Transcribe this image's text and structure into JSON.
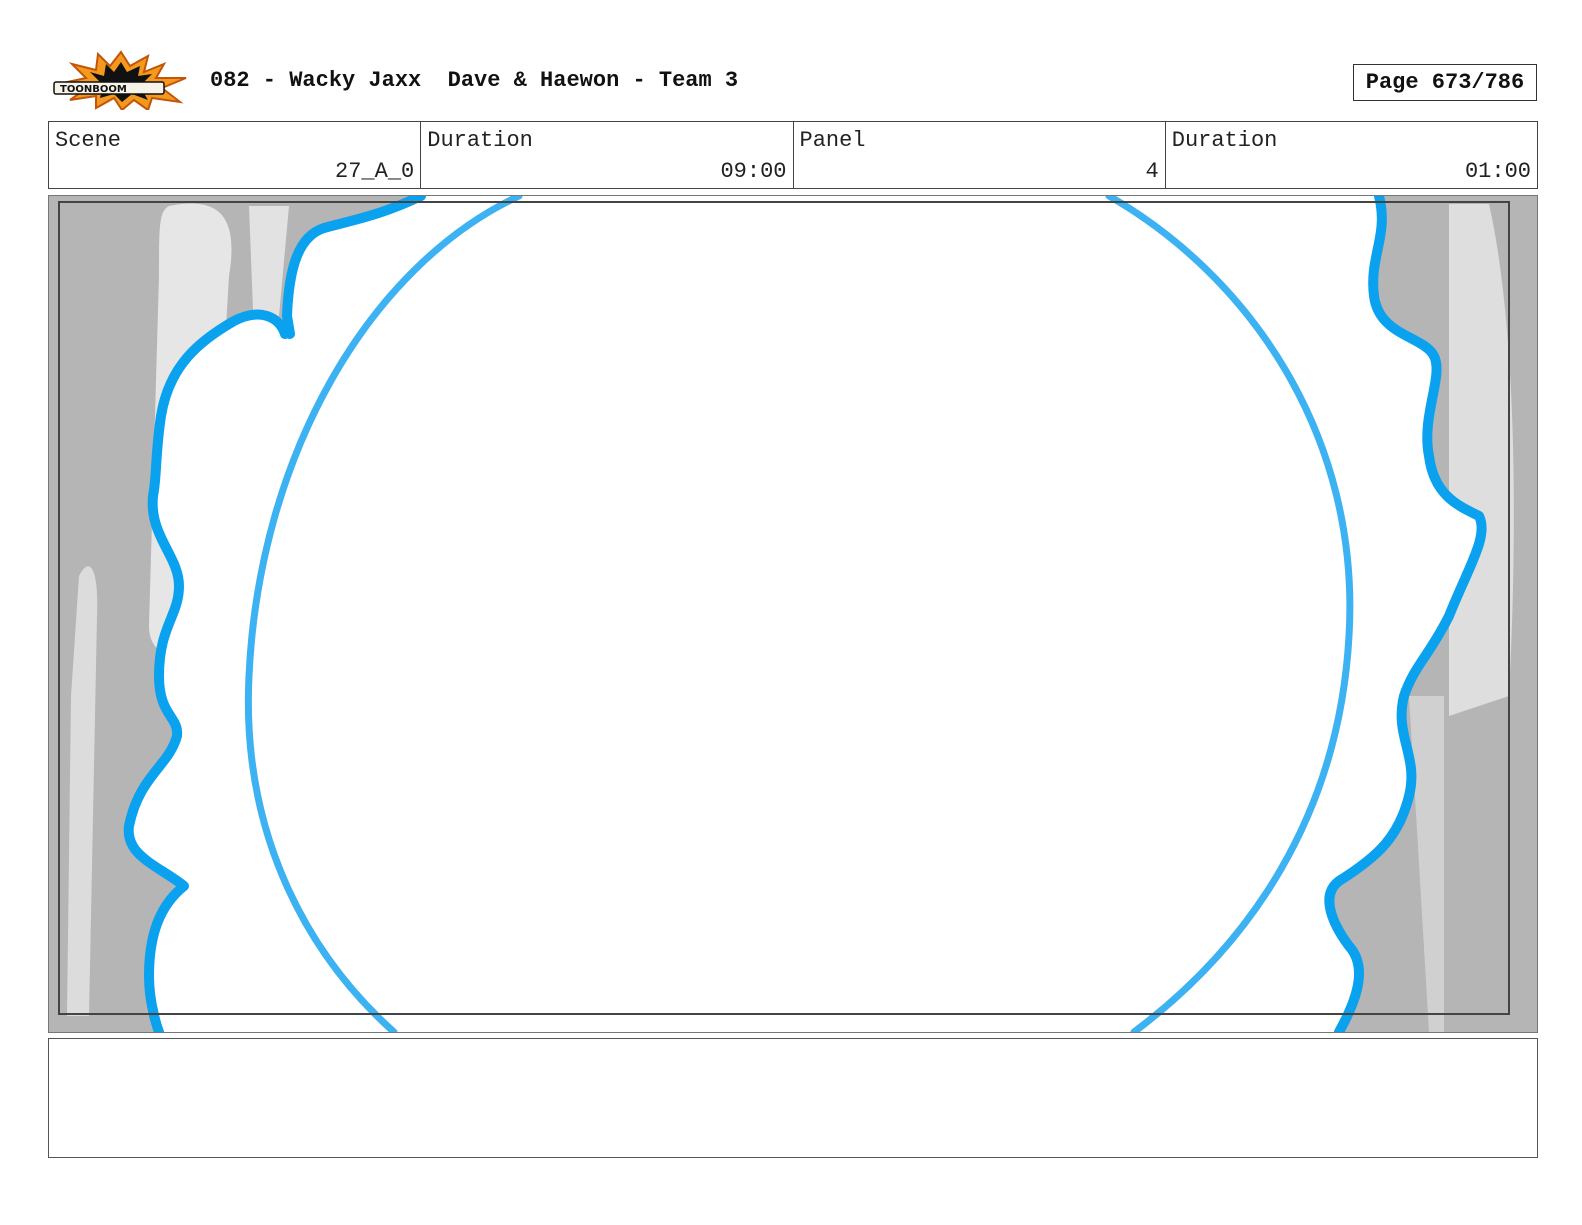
{
  "header": {
    "logo_text": "TOONBOOM",
    "title": "082 - Wacky Jaxx  Dave & Haewon - Team 3",
    "page": "Page 673/786"
  },
  "info": {
    "scene_label": "Scene",
    "scene_value": "27_A_0",
    "scene_duration_label": "Duration",
    "scene_duration_value": "09:00",
    "panel_label": "Panel",
    "panel_value": "4",
    "panel_duration_label": "Duration",
    "panel_duration_value": "01:00"
  },
  "colors": {
    "outline_blue": "#0aa2ef",
    "background_gray": "#b5b5b5",
    "highlight_gray": "#e6e6e6"
  },
  "notes": ""
}
